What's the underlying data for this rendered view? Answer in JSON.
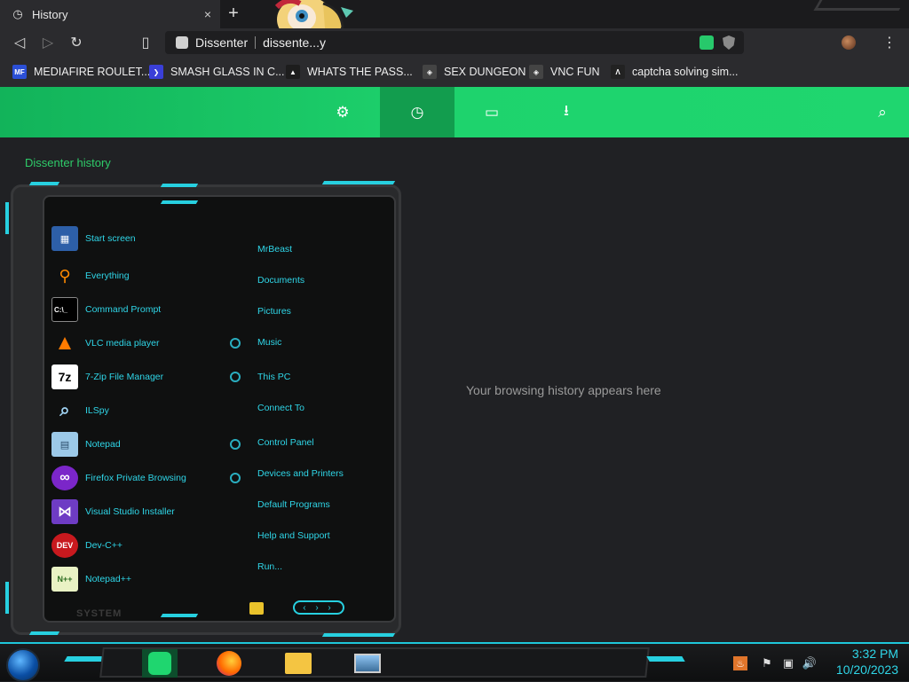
{
  "browser": {
    "tab_title": "History",
    "tab_close": "×",
    "new_tab": "+",
    "site_name": "Dissenter",
    "url": "dissente...y",
    "menu_glyph": "⋮"
  },
  "bookmarks": [
    {
      "label": "MEDIAFIRE ROULET...",
      "icon": "mediafire-icon",
      "color": "#2b4fd6",
      "glyph": "MF"
    },
    {
      "label": "SMASH GLASS IN C...",
      "icon": "chevron-logo-icon",
      "color": "#3a3fd8",
      "glyph": "❯"
    },
    {
      "label": "WHATS THE PASS...",
      "icon": "lock-icon",
      "color": "#1d1d1d",
      "glyph": "▲"
    },
    {
      "label": "SEX DUNGEON",
      "icon": "cube-icon",
      "color": "#444",
      "glyph": "◈"
    },
    {
      "label": "VNC FUN",
      "icon": "cube-icon",
      "color": "#444",
      "glyph": "◈"
    },
    {
      "label": "captcha solving sim...",
      "icon": "triangle-a-icon",
      "color": "#222",
      "glyph": "Λ"
    }
  ],
  "header_nav": [
    {
      "name": "settings",
      "icon": "gear-icon",
      "glyph": "⚙"
    },
    {
      "name": "history",
      "icon": "clock-icon",
      "glyph": "◷"
    },
    {
      "name": "bookmarks",
      "icon": "bookmark-icon",
      "glyph": "▭"
    },
    {
      "name": "downloads",
      "icon": "download-icon",
      "glyph": "⭳"
    }
  ],
  "search_glyph": "⌕",
  "page": {
    "title": "Dissenter history",
    "empty_message": "Your browsing history appears here"
  },
  "start_menu": {
    "programs": [
      {
        "label": "Start screen",
        "icon": "start-screen-icon",
        "bg": "#2d5fa8",
        "glyph": "▦"
      },
      {
        "label": "Everything",
        "icon": "magnifier-icon",
        "bg": "transparent",
        "glyph": "🔍"
      },
      {
        "label": "Command Prompt",
        "icon": "cmd-icon",
        "bg": "#000",
        "glyph": "C:\\_"
      },
      {
        "label": "VLC media player",
        "icon": "vlc-icon",
        "bg": "transparent",
        "glyph": "▲"
      },
      {
        "label": "7-Zip File Manager",
        "icon": "7zip-icon",
        "bg": "#fff",
        "glyph": "7z"
      },
      {
        "label": "ILSpy",
        "icon": "ilspy-icon",
        "bg": "transparent",
        "glyph": "⌕"
      },
      {
        "label": "Notepad",
        "icon": "notepad-icon",
        "bg": "#9cc9e8",
        "glyph": "▤"
      },
      {
        "label": "Firefox Private Browsing",
        "icon": "firefox-private-icon",
        "bg": "#7b26c9",
        "glyph": "∞"
      },
      {
        "label": "Visual Studio Installer",
        "icon": "vs-installer-icon",
        "bg": "#6e3cc4",
        "glyph": "⋈"
      },
      {
        "label": "Dev-C++",
        "icon": "devcpp-icon",
        "bg": "#c8191e",
        "glyph": "DEV"
      },
      {
        "label": "Notepad++",
        "icon": "notepadpp-icon",
        "bg": "#e9f2c4",
        "glyph": "N++"
      }
    ],
    "places": [
      "MrBeast",
      "Documents",
      "Pictures",
      "Music",
      "This PC",
      "Connect To",
      "Control Panel",
      "Devices and Printers",
      "Default Programs",
      "Help and Support",
      "Run..."
    ],
    "system_label": "SYSTEM"
  },
  "taskbar": {
    "time": "3:32 PM",
    "date": "10/20/2023"
  }
}
